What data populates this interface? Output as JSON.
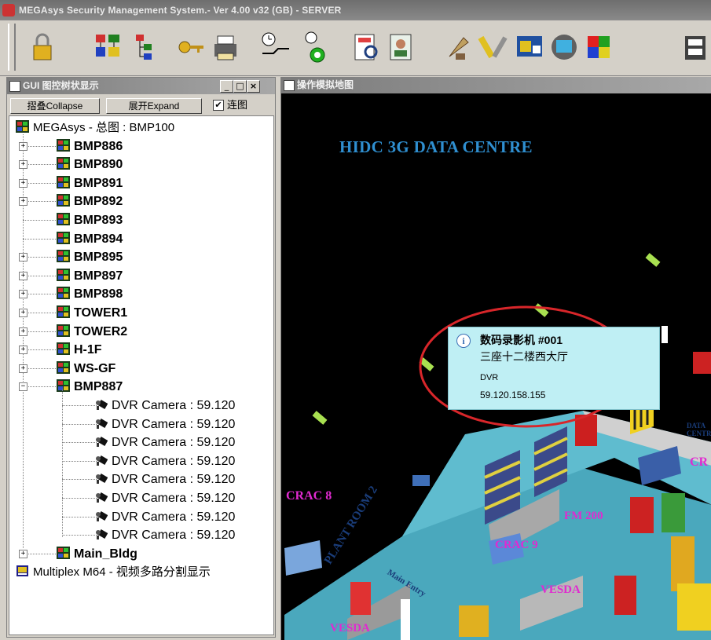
{
  "window": {
    "title": "MEGAsys Security Management System.- Ver 4.00 v32  (GB)  - SERVER"
  },
  "toolbar": {
    "icons": [
      "padlock-icon",
      "tree-chart-icon",
      "hierarchy-icon",
      "keys-icon",
      "printer-icon",
      "clock-schedule-icon",
      "clock-switch-icon",
      "report-search-icon",
      "user-report-icon",
      "satellite-icon",
      "tools-icon",
      "map-settings-icon",
      "monitor-icon",
      "color-grid-icon",
      "archive-icon"
    ]
  },
  "left_panel": {
    "title": "GUI 图控树状显示",
    "collapse_label": "摺叠Collapse",
    "expand_label": "展开Expand",
    "checkbox_label": "连图",
    "checkbox_checked": true,
    "tree": {
      "root_label": "MEGAsys - 总图 : BMP100",
      "nodes": [
        {
          "label": "BMP886",
          "expander": "+"
        },
        {
          "label": "BMP890",
          "expander": "+"
        },
        {
          "label": "BMP891",
          "expander": "+"
        },
        {
          "label": "BMP892",
          "expander": "+"
        },
        {
          "label": "BMP893",
          "expander": ""
        },
        {
          "label": "BMP894",
          "expander": ""
        },
        {
          "label": "BMP895",
          "expander": "+"
        },
        {
          "label": "BMP897",
          "expander": "+"
        },
        {
          "label": "BMP898",
          "expander": "+"
        },
        {
          "label": "TOWER1",
          "expander": "+"
        },
        {
          "label": "TOWER2",
          "expander": "+"
        },
        {
          "label": "H-1F",
          "expander": "+"
        },
        {
          "label": "WS-GF",
          "expander": "+"
        },
        {
          "label": "BMP887",
          "expander": "−"
        }
      ],
      "cameras": [
        "DVR Camera : 59.120",
        "DVR Camera : 59.120",
        "DVR Camera : 59.120",
        "DVR Camera : 59.120",
        "DVR Camera : 59.120",
        "DVR Camera : 59.120",
        "DVR Camera : 59.120",
        "DVR Camera : 59.120"
      ],
      "after_node": {
        "label": "Main_Bldg",
        "expander": "+"
      },
      "multiplex_label": "Multiplex M64 - 视频多路分割显示"
    }
  },
  "right_panel": {
    "title": "操作模拟地图",
    "map_title": "HIDC 3G DATA CENTRE",
    "tooltip": {
      "name": "数码录影机 #001",
      "location": "三座十二楼西大厅",
      "type": "DVR",
      "ip": "59.120.158.155"
    },
    "labels": {
      "crac8": "CRAC 8",
      "crac9": "CRAC 9",
      "fm200a": "FM 200",
      "fm200b": "FM 200",
      "vesda1": "VESDA",
      "vesda2": "VESDA",
      "plant_room": "PLANT ROOM 2",
      "main_entry": "Main Entry",
      "data_centre": "DATA CENTRE",
      "cr_partial": "CR"
    }
  },
  "colors": {
    "map_bg": "#000000",
    "tooltip_bg": "#bfeff4",
    "highlight_ellipse": "#d8262a",
    "label_magenta": "#e02ad0",
    "title_blue": "#2f8fd0"
  }
}
